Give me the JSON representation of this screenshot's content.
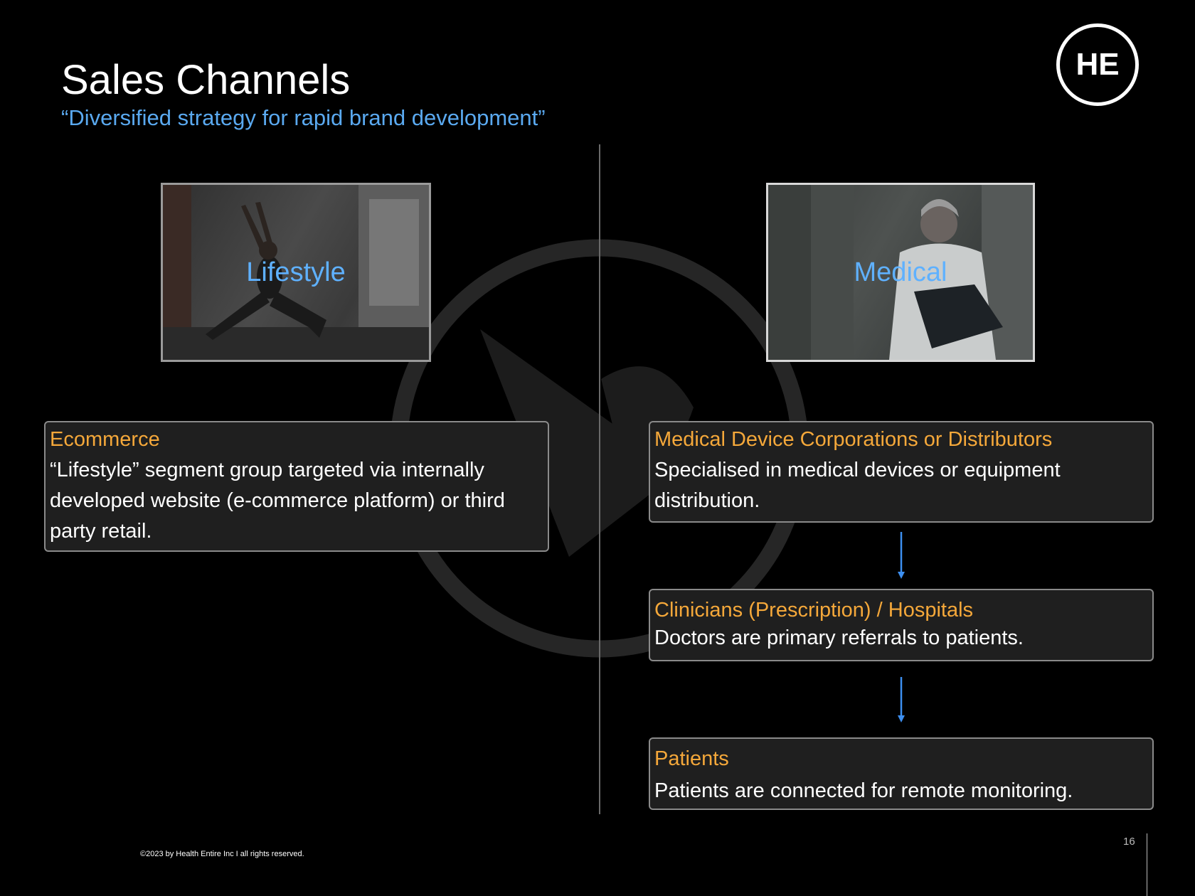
{
  "header": {
    "title": "Sales Channels",
    "subtitle": "“Diversified strategy for rapid brand development”",
    "logo_text": "HE"
  },
  "photos": {
    "lifestyle_label": "Lifestyle",
    "medical_label": "Medical"
  },
  "lifestyle_channel": {
    "title": "Ecommerce",
    "body": "“Lifestyle” segment group targeted via internally developed website (e-commerce platform) or third party retail."
  },
  "medical_channel": [
    {
      "title": "Medical Device Corporations or Distributors",
      "body": "Specialised in medical devices or equipment distribution."
    },
    {
      "title": "Clinicians (Prescription) / Hospitals",
      "body": "Doctors are primary referrals to patients."
    },
    {
      "title": "Patients",
      "body": "Patients are connected for remote monitoring."
    }
  ],
  "footer": {
    "copyright": "©2023 by Health Entire Inc I all rights reserved.",
    "page_number": "16"
  },
  "colors": {
    "background": "#000000",
    "accent_blue": "#5aa9f0",
    "accent_orange": "#f5a83a",
    "box_background": "#1f1f1f",
    "arrow_blue": "#3d8ff0"
  },
  "icons": {
    "logo": "he-logo-icon",
    "watermark": "circle-arrow-watermark-icon",
    "arrow": "arrow-down-icon"
  }
}
